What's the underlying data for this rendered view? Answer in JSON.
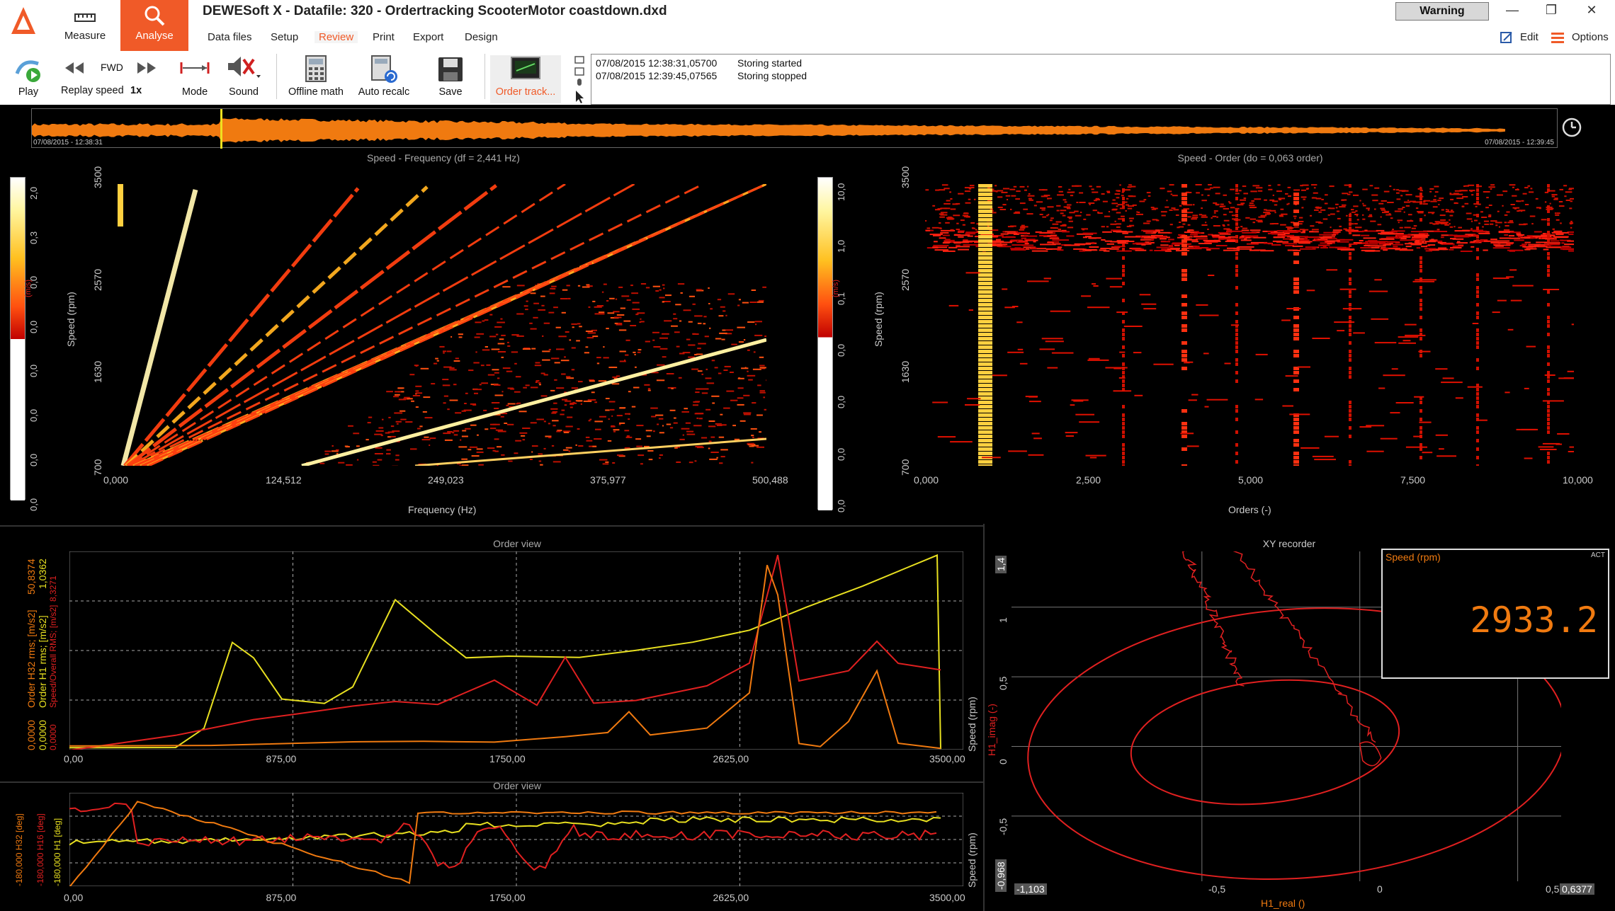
{
  "app": {
    "title": "DEWESoft X - Datafile: 320 - Ordertracking ScooterMotor coastdown.dxd",
    "warning": "Warning"
  },
  "mode_tabs": {
    "measure": "Measure",
    "analyse": "Analyse"
  },
  "menu": {
    "data_files": "Data files",
    "setup": "Setup",
    "review": "Review",
    "print": "Print",
    "export": "Export",
    "design": "Design",
    "edit": "Edit",
    "options": "Options"
  },
  "ribbon": {
    "play": "Play",
    "fwd": "FWD",
    "replay_speed": "Replay speed",
    "replay_speed_value": "1x",
    "mode": "Mode",
    "sound": "Sound",
    "offline_math": "Offline math",
    "auto_recalc": "Auto recalc",
    "save": "Save",
    "order_tracking": "Order track..."
  },
  "events": [
    {
      "time": "07/08/2015 12:38:31,05700",
      "text": "Storing started"
    },
    {
      "time": "07/08/2015 12:39:45,07565",
      "text": "Storing stopped"
    }
  ],
  "overview": {
    "start": "07/08/2015 - 12:38:31",
    "end": "07/08/2015 - 12:39:45"
  },
  "freq_plot": {
    "title": "Speed - Frequency (df = 2,441 Hz)",
    "xlabel": "Frequency (Hz)",
    "ylabel": "Speed (rpm)",
    "xticks": [
      "0,000",
      "124,512",
      "249,023",
      "375,977",
      "500,488"
    ],
    "yticks": [
      "3500",
      "2570",
      "1630",
      "700"
    ],
    "cbar_ticks": [
      "2,0",
      "0,3",
      "0,0",
      "0,0",
      "0,0",
      "0,0",
      "0,0",
      "0,0"
    ],
    "cbar_unit": "(m/s)"
  },
  "order_plot": {
    "title": "Speed - Order (do = 0,063 order)",
    "xlabel": "Orders (-)",
    "ylabel": "Speed (rpm)",
    "xticks": [
      "0,000",
      "2,500",
      "5,000",
      "7,500",
      "10,000"
    ],
    "yticks": [
      "3500",
      "2570",
      "1630",
      "700"
    ],
    "cbar_ticks": [
      "10,0",
      "1,0",
      "0,1",
      "0,0",
      "0,0",
      "0,0",
      "0,0"
    ],
    "cbar_unit": "(m/s)"
  },
  "order_view_1": {
    "title": "Order view",
    "xticks": [
      "0,00",
      "875,00",
      "1750,00",
      "2625,00",
      "3500,00"
    ],
    "right_label": "Speed (rpm)",
    "left_labels": [
      {
        "text": "Order H32 rms; [m/s2]",
        "color": "#f07a10"
      },
      {
        "text": "Order H1 rms; [m/s2]",
        "color": "#e8e020"
      },
      {
        "text": "Speed/Overall RMS; [m/s2]",
        "color": "#e02020"
      }
    ],
    "left_values_top": [
      "50,8374",
      "1,0362",
      "8,3271"
    ],
    "left_values_bottom": [
      "0,0000",
      "0,0000",
      "0,0000"
    ]
  },
  "order_view_2": {
    "title": "Order view",
    "xticks": [
      "0,00",
      "875,00",
      "1750,00",
      "2625,00",
      "3500,00"
    ],
    "right_label": "Speed (rpm)",
    "left_labels": [
      {
        "text": "-180,000 H32 [deg]",
        "color": "#f07a10"
      },
      {
        "text": "-180,000 H16 [deg]",
        "color": "#e02020"
      },
      {
        "text": "-180,000 H1 [deg]",
        "color": "#e8e020"
      }
    ]
  },
  "xy_recorder": {
    "title": "XY recorder",
    "xlabel": "H1_real ()",
    "ylabel": "H1_imag (-)",
    "yticks": [
      "1,4",
      "1",
      "0,5",
      "0",
      "-0,5",
      "-0,968"
    ],
    "xticks": [
      "-1,103",
      "-0,5",
      "0",
      "0,5",
      "0,6377"
    ]
  },
  "speed_display": {
    "label": "Speed (rpm)",
    "status": "ACT",
    "value": "2933.2"
  },
  "colors": {
    "accent": "#f05a28",
    "trace_orange": "#f07a10",
    "trace_yellow": "#e8e020",
    "trace_red": "#e02020"
  }
}
